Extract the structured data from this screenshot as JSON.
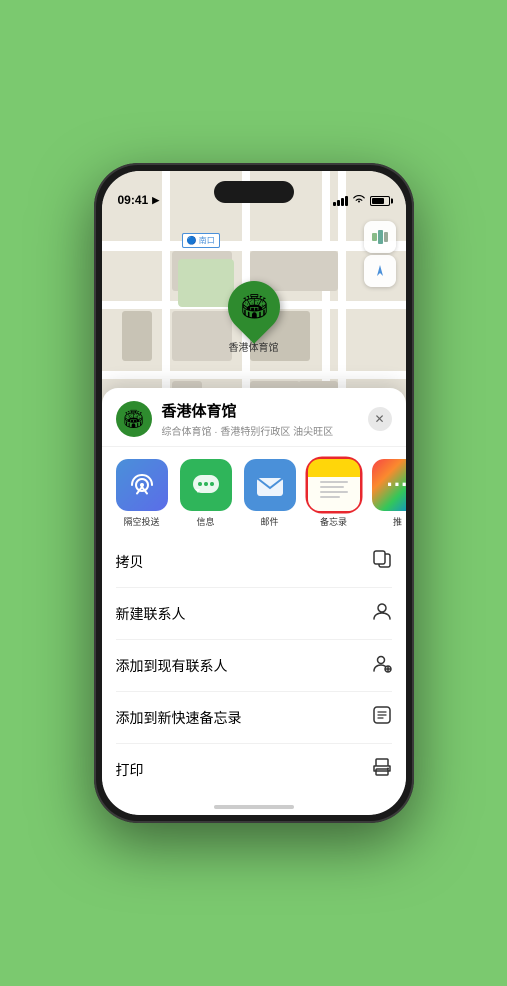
{
  "statusBar": {
    "time": "09:41",
    "locationArrow": "▶"
  },
  "map": {
    "southGateLabel": "南口",
    "locationPin": "🏟",
    "locationName": "香港体育馆",
    "mapTypeBtn": "🗺",
    "locationBtn": "➤"
  },
  "sheet": {
    "venueName": "香港体育馆",
    "venueDesc": "综合体育馆 · 香港特别行政区 油尖旺区",
    "closeBtn": "✕",
    "venueEmoji": "🏟"
  },
  "shareItems": [
    {
      "id": "airdrop",
      "label": "隔空投送",
      "emoji": "📡"
    },
    {
      "id": "messages",
      "label": "信息",
      "emoji": "💬"
    },
    {
      "id": "mail",
      "label": "邮件",
      "emoji": "✉️"
    },
    {
      "id": "notes",
      "label": "备忘录",
      "emoji": ""
    },
    {
      "id": "more",
      "label": "推",
      "emoji": "⋯"
    }
  ],
  "actionItems": [
    {
      "label": "拷贝",
      "icon": "⎘"
    },
    {
      "label": "新建联系人",
      "icon": "👤"
    },
    {
      "label": "添加到现有联系人",
      "icon": "👤"
    },
    {
      "label": "添加到新快速备忘录",
      "icon": "📋"
    },
    {
      "label": "打印",
      "icon": "🖨"
    }
  ]
}
